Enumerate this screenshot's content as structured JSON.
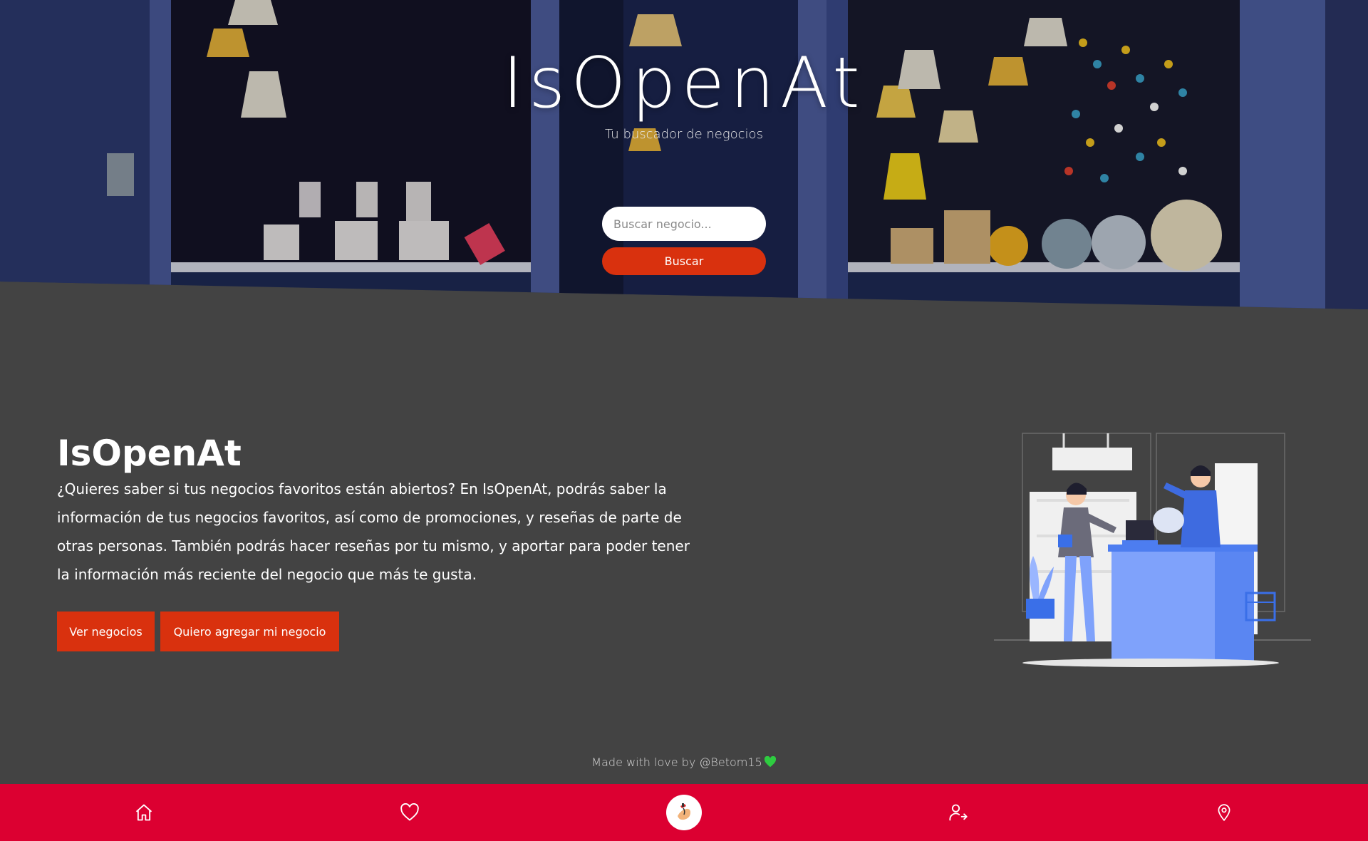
{
  "hero": {
    "title": "IsOpenAt",
    "subtitle": "Tu buscador de negocios",
    "search": {
      "placeholder": "Buscar negocio...",
      "value": ""
    },
    "search_button": "Buscar"
  },
  "main": {
    "title": "IsOpenAt",
    "description": "¿Quieres saber si tus negocios favoritos están abiertos? En IsOpenAt, podrás saber la información de tus negocios favoritos, así como de promociones, y reseñas de parte de otras personas. También podrás hacer reseñas por tu mismo, y aportar para poder tener la información más reciente del negocio que más te gusta.",
    "buttons": {
      "view": "Ver negocios",
      "add": "Quiero agregar mi negocio"
    }
  },
  "footer": {
    "credit": "Made with love by @Betom15"
  },
  "bottom_nav": {
    "items": [
      "home-icon",
      "heart-icon",
      "logo-icon",
      "user-arrow-icon",
      "location-pin-icon"
    ]
  },
  "colors": {
    "accent": "#d9310e",
    "nav": "#dc0031",
    "background": "#434343",
    "heart": "#2ecc40"
  }
}
